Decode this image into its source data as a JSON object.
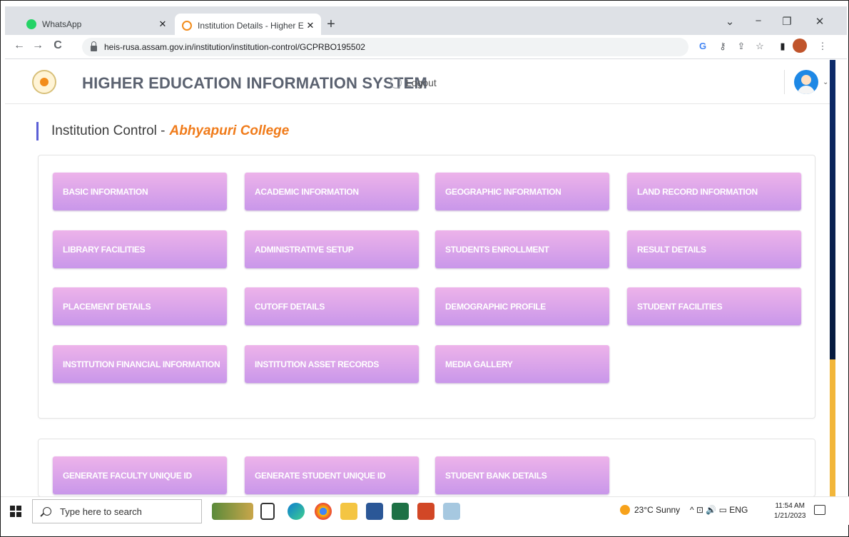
{
  "browser": {
    "tabs": [
      {
        "title": "WhatsApp",
        "favicon": "whatsapp-icon",
        "active": false
      },
      {
        "title": "Institution Details - Higher Educa",
        "favicon": "site-icon",
        "active": true
      }
    ],
    "new_tab": "+",
    "url": "heis-rusa.assam.gov.in/institution/institution-control/GCPRBO195502",
    "nav": {
      "back": "←",
      "forward": "→",
      "reload": "C"
    },
    "window_controls": {
      "dropdown": "⌄",
      "minimize": "−",
      "restore": "❐",
      "close": "✕"
    },
    "toolbar_icons": {
      "google": "G",
      "key": "⚷",
      "share": "⇪",
      "star": "☆",
      "sidepanel": "▮",
      "menu": "⋮"
    }
  },
  "header": {
    "title": "HIGHER EDUCATION INFORMATION SYSTEM",
    "logout": "Logout"
  },
  "page": {
    "title": "Institution Control -",
    "college": "Abhyapuri College"
  },
  "sections": [
    {
      "buttons": [
        "BASIC INFORMATION",
        "ACADEMIC INFORMATION",
        "GEOGRAPHIC INFORMATION",
        "LAND RECORD INFORMATION",
        "LIBRARY FACILITIES",
        "ADMINISTRATIVE SETUP",
        "STUDENTS ENROLLMENT",
        "RESULT DETAILS",
        "PLACEMENT DETAILS",
        "CUTOFF DETAILS",
        "DEMOGRAPHIC PROFILE",
        "STUDENT FACILITIES",
        "INSTITUTION FINANCIAL INFORMATION",
        "INSTITUTION ASSET RECORDS",
        "MEDIA GALLERY"
      ]
    },
    {
      "buttons": [
        "GENERATE FACULTY UNIQUE ID",
        "GENERATE STUDENT UNIQUE ID",
        "STUDENT BANK DETAILS"
      ]
    }
  ],
  "taskbar": {
    "search_placeholder": "Type here to search",
    "weather": "23°C  Sunny",
    "tray": "^  ⊡  🔊  ▭  ENG",
    "time": "11:54 AM",
    "date": "1/21/2023"
  },
  "colors": {
    "button_top": "#edb3ea",
    "button_bottom": "#c997ea",
    "college_name": "#f07b1a",
    "title_bar_accent": "#5b5fd6"
  }
}
